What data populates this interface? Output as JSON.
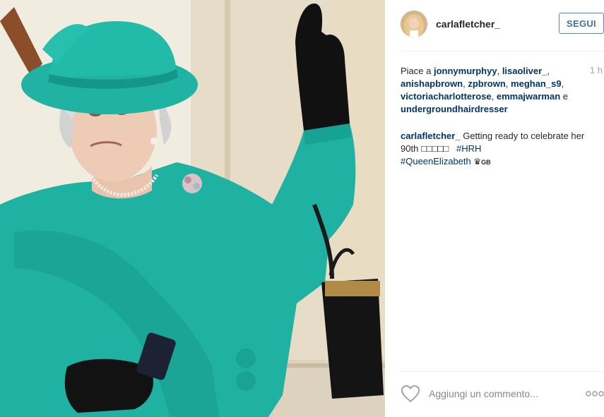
{
  "post": {
    "image_alt": "",
    "author": {
      "username": "carlafletcher_"
    },
    "follow_label": "SEGUI",
    "time_ago": "1 h",
    "likes": {
      "prefix": "Piace a",
      "users": [
        "jonnymurphyy",
        "lisaoliver_",
        "anishapbrown",
        "zpbrown",
        "meghan_s9",
        "victoriacharlotterose",
        "emmajwarman"
      ],
      "conjunction": "e",
      "last_user": "undergroundhairdresser"
    },
    "caption": {
      "username": "carlafletcher_",
      "text": "Getting ready to celebrate her 90th",
      "emoji_boxes": "□□□□□",
      "hashtag_1": "#HRH",
      "hashtag_2": "#QueenElizabeth",
      "crown": "♛",
      "flag_code": "GB"
    },
    "comment_placeholder": "Aggiungi un commento...",
    "icons": {
      "like": "heart-icon",
      "more": "more-options-icon"
    }
  },
  "colors": {
    "link": "#003569",
    "follow_border": "#4f88c3",
    "follow_text": "#3f729b",
    "muted": "#a5a7aa",
    "divider": "#efefef",
    "coat": "#1fb2a2"
  }
}
